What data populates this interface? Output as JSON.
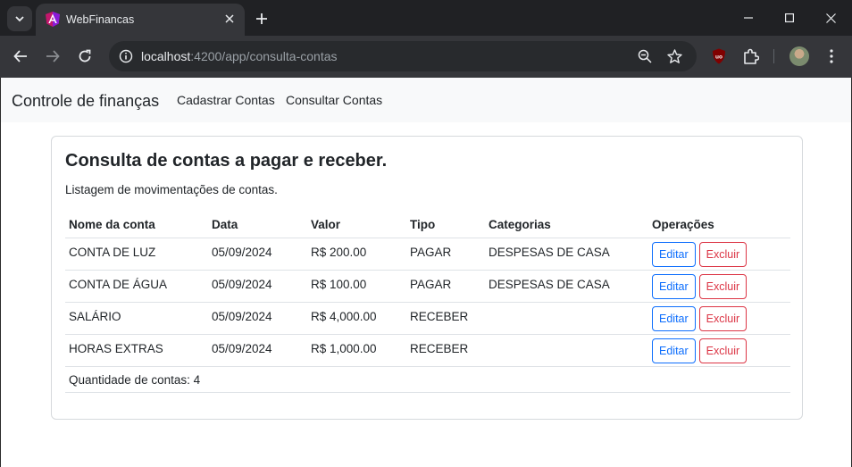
{
  "browser": {
    "tab_title": "WebFinancas",
    "url_host": "localhost",
    "url_path": ":4200/app/consulta-contas"
  },
  "icons": {
    "tab_search": "chevron-down-icon",
    "close": "close-icon",
    "new_tab": "plus-icon",
    "back": "arrow-left-icon",
    "forward": "arrow-right-icon",
    "reload": "reload-icon",
    "site_info": "info-icon",
    "zoom": "zoom-out-icon",
    "bookmark": "star-icon",
    "extensions": "puzzle-icon",
    "menu": "kebab-menu-icon"
  },
  "navbar": {
    "brand": "Controle de finanças",
    "links": [
      "Cadastrar Contas",
      "Consultar Contas"
    ]
  },
  "card": {
    "title": "Consulta de contas a pagar e receber.",
    "subtitle": "Listagem de movimentações de contas."
  },
  "table": {
    "headers": [
      "Nome da conta",
      "Data",
      "Valor",
      "Tipo",
      "Categorias",
      "Operações"
    ],
    "rows": [
      {
        "nome": "CONTA DE LUZ",
        "data": "05/09/2024",
        "valor": "R$ 200.00",
        "tipo": "PAGAR",
        "categoria": "DESPESAS DE CASA"
      },
      {
        "nome": "CONTA DE ÁGUA",
        "data": "05/09/2024",
        "valor": "R$ 100.00",
        "tipo": "PAGAR",
        "categoria": "DESPESAS DE CASA"
      },
      {
        "nome": "SALÁRIO",
        "data": "05/09/2024",
        "valor": "R$ 4,000.00",
        "tipo": "RECEBER",
        "categoria": ""
      },
      {
        "nome": "HORAS EXTRAS",
        "data": "05/09/2024",
        "valor": "R$ 1,000.00",
        "tipo": "RECEBER",
        "categoria": ""
      }
    ],
    "edit_label": "Editar",
    "delete_label": "Excluir",
    "footer": "Quantidade de contas: 4"
  },
  "colors": {
    "primary": "#0d6efd",
    "danger": "#dc3545",
    "navbar_bg": "#f8f9fa",
    "chrome_dark": "#202124"
  }
}
